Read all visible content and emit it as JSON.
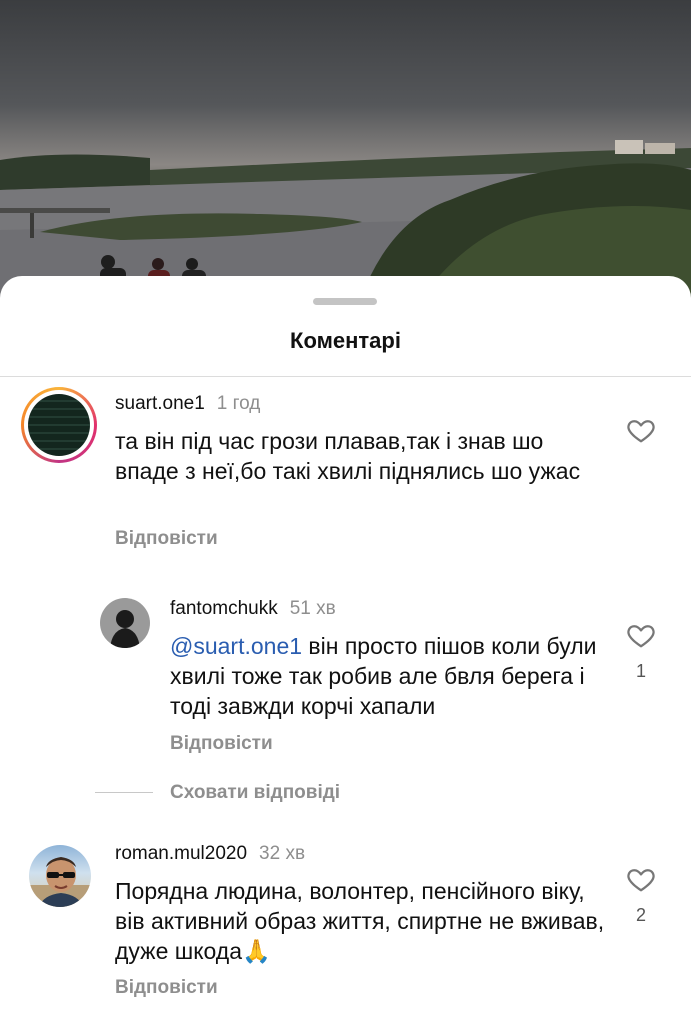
{
  "sheet": {
    "title": "Коментарі"
  },
  "comments": [
    {
      "username": "suart.one1",
      "time": "1 год",
      "text": "та він під час грози плавав,так і знав шо впаде з неї,бо такі хвилі піднялись шо ужас",
      "reply_label": "Відповісти",
      "likes": ""
    },
    {
      "username": "fantomchukk",
      "time": "51 хв",
      "mention": "@suart.one1",
      "text": " він просто пішов коли були хвилі тоже так робив але бвля берега і тоді завжди корчі хапали",
      "reply_label": "Відповісти",
      "likes": "1"
    },
    {
      "username": "roman.mul2020",
      "time": "32 хв",
      "text": "Порядна людина, волонтер, пенсійного віку, вів активний образ життя, спиртне не вживав, дуже шкода🙏",
      "reply_label": "Відповісти",
      "likes": "2"
    }
  ],
  "hide_replies_label": "Сховати відповіді",
  "icons": {
    "like": "heart-outline-icon"
  }
}
